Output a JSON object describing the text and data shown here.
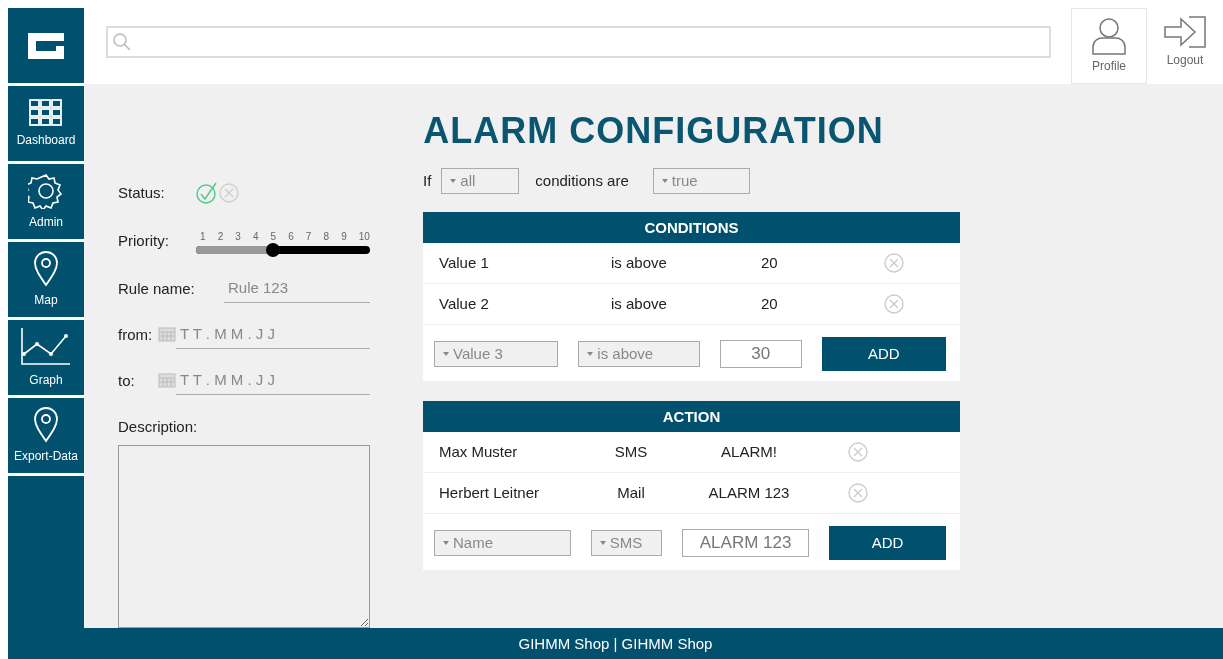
{
  "sidebar": {
    "items": [
      {
        "label": "Dashboard",
        "kind": "grid"
      },
      {
        "label": "Admin",
        "kind": "gear"
      },
      {
        "label": "Map",
        "kind": "pin"
      },
      {
        "label": "Graph",
        "kind": "chart"
      },
      {
        "label": "Export-Data",
        "kind": "pin"
      }
    ]
  },
  "header": {
    "buttons": [
      {
        "label": "Profile",
        "kind": "person",
        "selected": true
      },
      {
        "label": "Logout",
        "kind": "exit",
        "selected": false
      }
    ]
  },
  "title": "ALARM CONFIGURATION",
  "form": {
    "status_label": "Status:",
    "status_options": [
      {
        "kind": "check",
        "selected": true
      },
      {
        "kind": "cross",
        "selected": false
      }
    ],
    "priority_label": "Priority:",
    "priority_ticks": [
      "1",
      "2",
      "3",
      "4",
      "5",
      "6",
      "7",
      "8",
      "9",
      "10"
    ],
    "priority": {
      "level": 0.44
    },
    "rule_label": "Rule name:",
    "rule_placeholder": "Rule 123",
    "from_label": "from:",
    "from_placeholder": "T T . M M . J J",
    "to_label": "to:",
    "to_placeholder": "T T . M M . J J",
    "description_label": "Description:"
  },
  "rule": {
    "if": "If",
    "match": "all",
    "middle": "conditions are",
    "truth": "true"
  },
  "conditions": {
    "title": "CONDITIONS",
    "rows": [
      [
        "Value 1",
        "is above",
        "20"
      ],
      [
        "Value 2",
        "is above",
        "20"
      ]
    ],
    "new": {
      "field": "Value 3",
      "operator": "is above",
      "value": "30",
      "button": "ADD"
    }
  },
  "action": {
    "title": "ACTION",
    "rows": [
      [
        "Max Muster",
        "SMS",
        "ALARM!"
      ],
      [
        "Herbert Leitner",
        "Mail",
        "ALARM 123"
      ]
    ],
    "new": {
      "field": "Name",
      "operator": "SMS",
      "value": "ALARM 123",
      "button": "ADD"
    }
  },
  "footer": "GIHMM Shop | GIHMM Shop"
}
